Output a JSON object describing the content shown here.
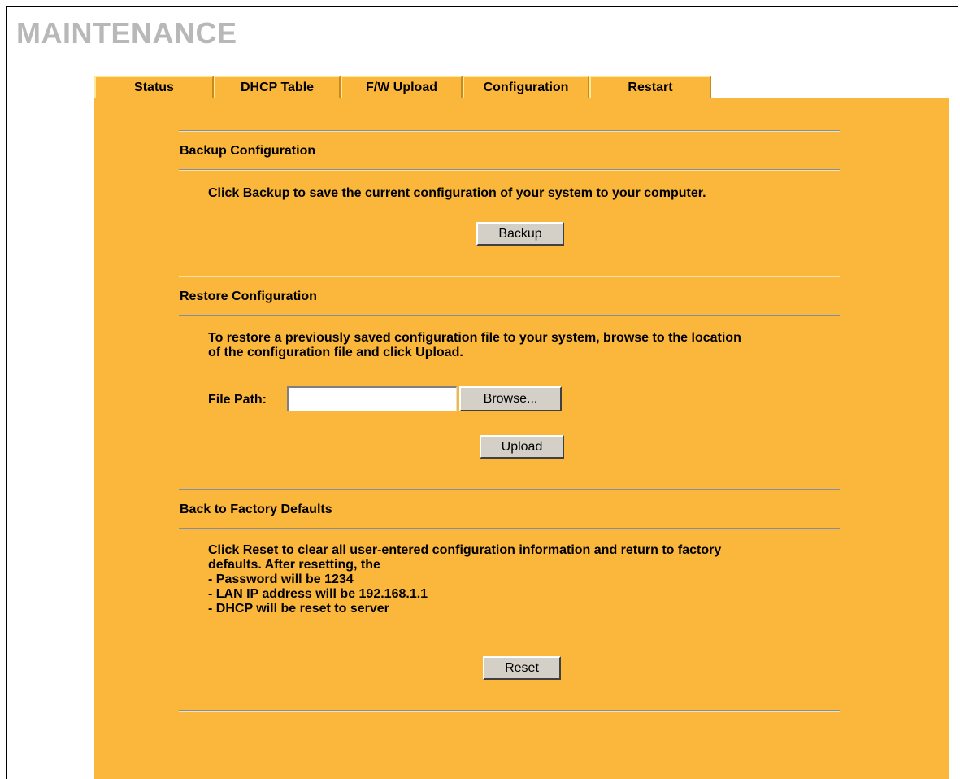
{
  "page_title": "MAINTENANCE",
  "tabs": [
    {
      "label": "Status",
      "active": false
    },
    {
      "label": "DHCP Table",
      "active": false
    },
    {
      "label": "F/W Upload",
      "active": false
    },
    {
      "label": "Configuration",
      "active": true
    },
    {
      "label": "Restart",
      "active": false
    }
  ],
  "backup": {
    "title": "Backup Configuration",
    "description": "Click Backup to save the current configuration of your system to your computer.",
    "button_label": "Backup"
  },
  "restore": {
    "title": "Restore Configuration",
    "description_line1": "To restore a previously saved configuration file to your system, browse to the location",
    "description_line2": "of the configuration file and click Upload.",
    "file_path_label": "File Path:",
    "file_path_value": "",
    "browse_label": "Browse...",
    "upload_label": "Upload"
  },
  "factory": {
    "title": "Back to Factory Defaults",
    "description_line1": "Click Reset to clear all user-entered configuration information and return to factory",
    "description_line2": "defaults. After resetting, the",
    "items": [
      "- Password will be 1234",
      "- LAN IP address will be 192.168.1.1",
      "- DHCP will be reset to server"
    ],
    "reset_label": "Reset"
  },
  "colors": {
    "panel_background": "#fbb73c",
    "title_gray": "#b8b8b8",
    "button_face": "#d4d0c8"
  }
}
